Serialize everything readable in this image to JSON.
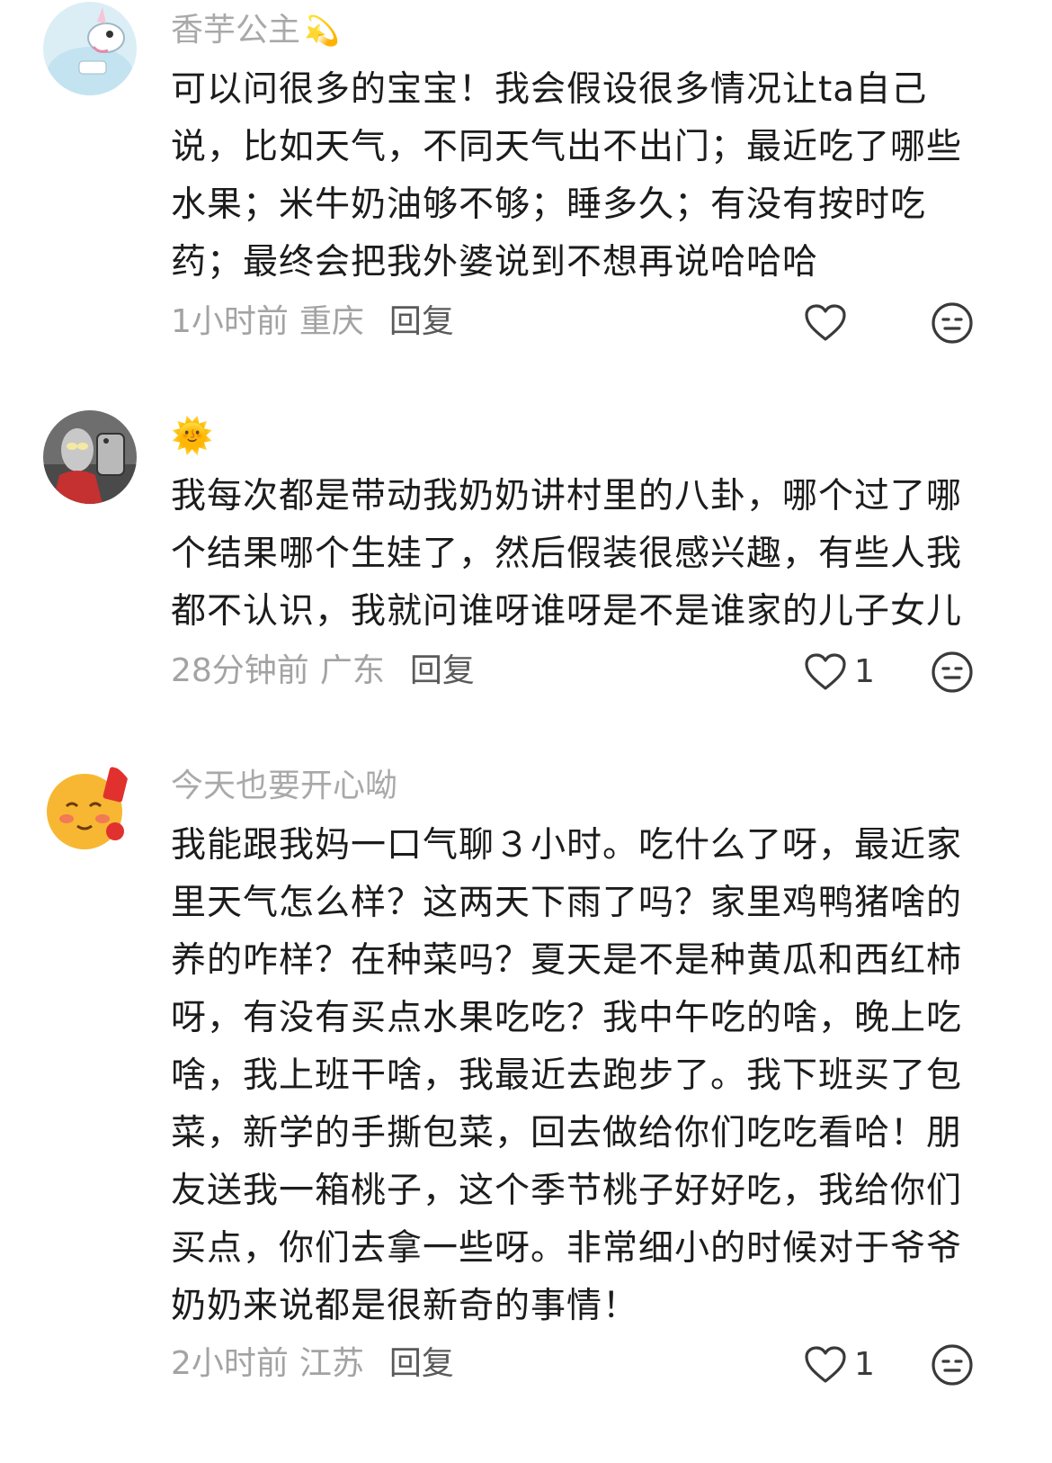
{
  "comments": [
    {
      "username": "香芋公主",
      "username_emoji": "💫",
      "text": "可以问很多的宝宝！我会假设很多情况让ta自己说，比如天气，不同天气出不出门；最近吃了哪些水果；米牛奶油够不够；睡多久；有没有按时吃药；最终会把我外婆说到不想再说哈哈哈",
      "time": "1小时前",
      "location": "重庆",
      "reply_label": "回复",
      "likes": ""
    },
    {
      "username": "",
      "username_emoji": "🌞",
      "text": "我每次都是带动我奶奶讲村里的八卦，哪个过了哪个结果哪个生娃了，然后假装很感兴趣，有些人我都不认识，我就问谁呀谁呀是不是谁家的儿子女儿",
      "time": "28分钟前",
      "location": "广东",
      "reply_label": "回复",
      "likes": "1"
    },
    {
      "username": "今天也要开心呦",
      "username_emoji": "",
      "text": "我能跟我妈一口气聊３小时。吃什么了呀，最近家里天气怎么样？这两天下雨了吗？家里鸡鸭猪啥的养的咋样？在种菜吗？夏天是不是种黄瓜和西红柿呀，有没有买点水果吃吃？我中午吃的啥，晚上吃啥，我上班干啥，我最近去跑步了。我下班买了包菜，新学的手撕包菜，回去做给你们吃吃看哈！朋友送我一箱桃子，这个季节桃子好好吃，我给你们买点，你们去拿一些呀。非常细小的时候对于爷爷奶奶来说都是很新奇的事情！",
      "time": "2小时前",
      "location": "江苏",
      "reply_label": "回复",
      "likes": "1"
    }
  ],
  "icons": {
    "like": "heart-outline-icon",
    "dislike": "neutral-face-icon"
  },
  "colors": {
    "username": "#a9a9a9",
    "meta": "#a3a3a3",
    "text": "#1c1c1c",
    "icon": "#3a3a3a"
  }
}
